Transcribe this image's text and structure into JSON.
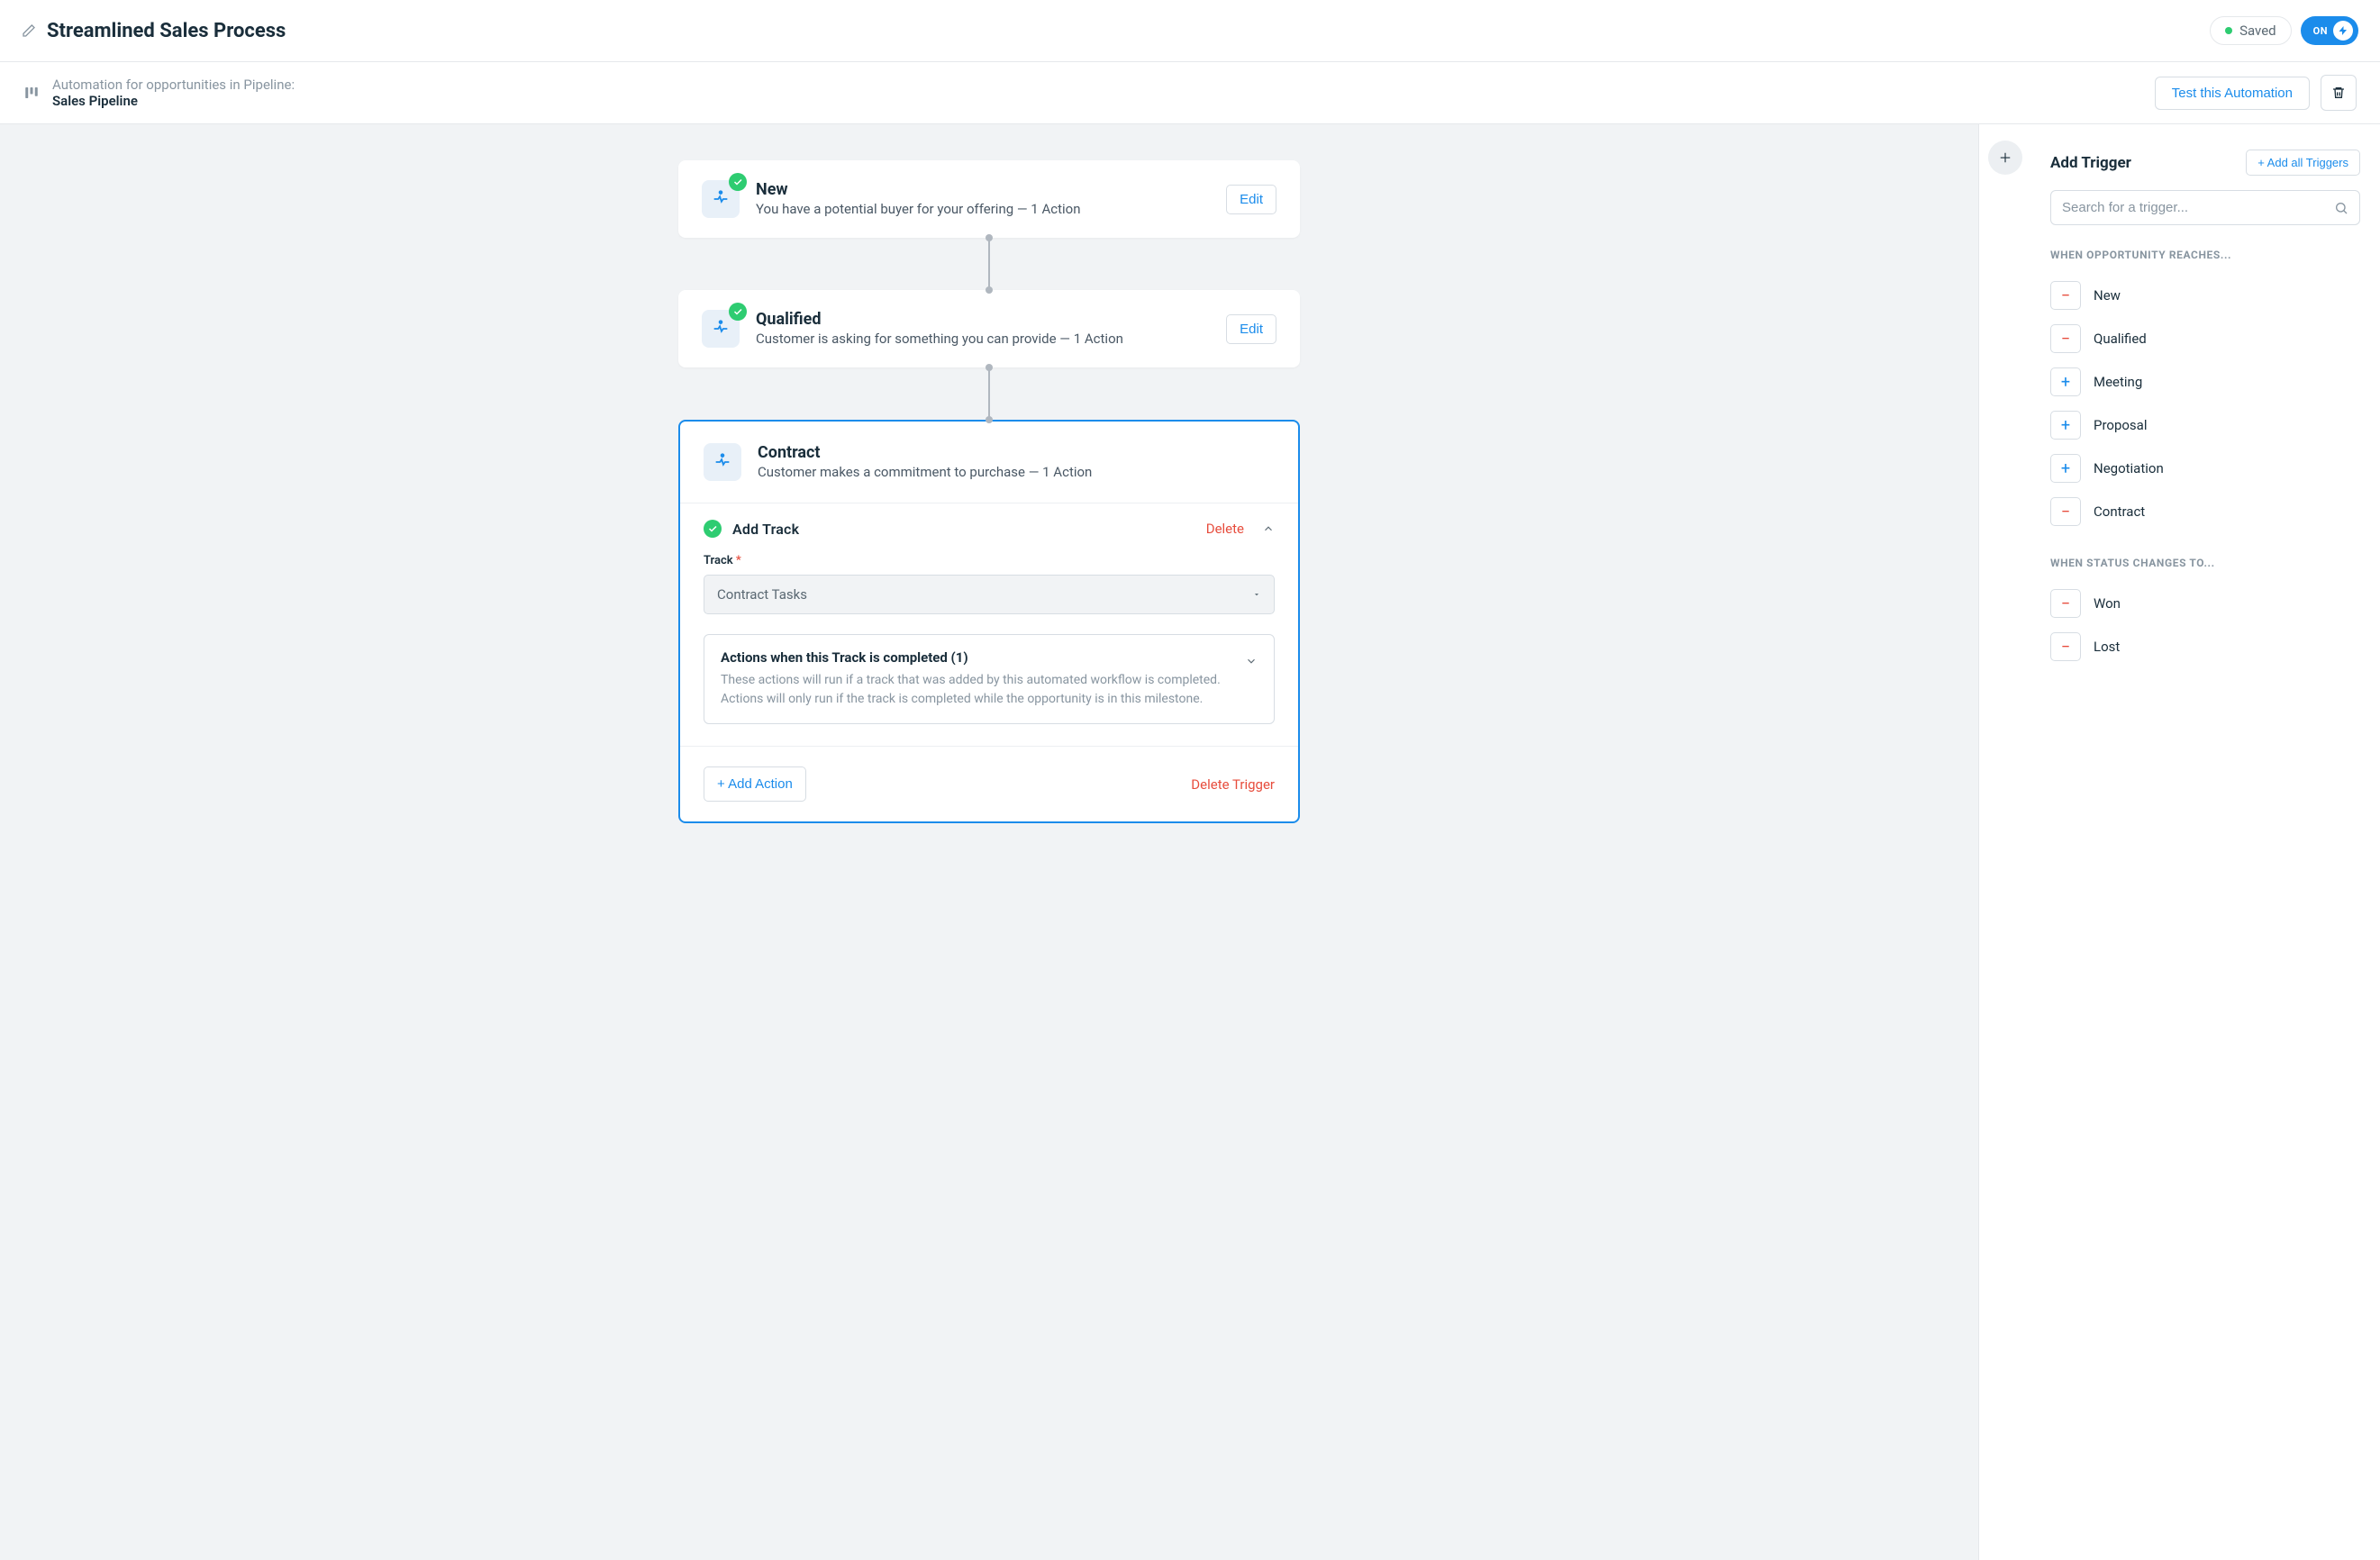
{
  "header": {
    "title": "Streamlined Sales Process",
    "saved_label": "Saved",
    "on_label": "ON"
  },
  "subheader": {
    "desc": "Automation for opportunities in Pipeline:",
    "pipeline": "Sales Pipeline",
    "test_label": "Test this Automation"
  },
  "flow": {
    "nodes": [
      {
        "title": "New",
        "subtitle": "You have a potential buyer for your offering — 1 Action",
        "edit": "Edit"
      },
      {
        "title": "Qualified",
        "subtitle": "Customer is asking for something you can provide — 1 Action",
        "edit": "Edit"
      }
    ],
    "expanded": {
      "title": "Contract",
      "subtitle": "Customer makes a commitment to purchase — 1 Action",
      "section_title": "Add Track",
      "delete_label": "Delete",
      "form_label": "Track",
      "select_value": "Contract Tasks",
      "panel_title": "Actions when this Track is completed (1)",
      "panel_desc": "These actions will run if a track that was added by this automated workflow is completed. Actions will only run if the track is completed while the opportunity is in this milestone.",
      "add_action": "+ Add Action",
      "delete_trigger": "Delete Trigger"
    }
  },
  "sidebar": {
    "title": "Add Trigger",
    "add_all": "+ Add all Triggers",
    "search_placeholder": "Search for a trigger...",
    "group1_label": "WHEN OPPORTUNITY REACHES...",
    "group1": [
      {
        "label": "New",
        "added": true
      },
      {
        "label": "Qualified",
        "added": true
      },
      {
        "label": "Meeting",
        "added": false
      },
      {
        "label": "Proposal",
        "added": false
      },
      {
        "label": "Negotiation",
        "added": false
      },
      {
        "label": "Contract",
        "added": true
      }
    ],
    "group2_label": "WHEN STATUS CHANGES TO...",
    "group2": [
      {
        "label": "Won",
        "added": true
      },
      {
        "label": "Lost",
        "added": true
      }
    ]
  }
}
